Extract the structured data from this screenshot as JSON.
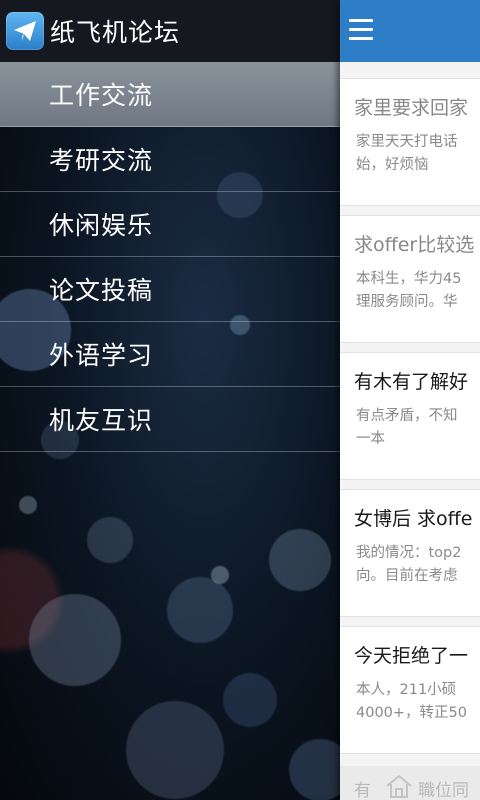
{
  "app": {
    "title": "纸飞机论坛",
    "logo_icon": "paper-plane-icon"
  },
  "drawer": {
    "items": [
      {
        "label": "工作交流",
        "active": true
      },
      {
        "label": "考研交流",
        "active": false
      },
      {
        "label": "休闲娱乐",
        "active": false
      },
      {
        "label": "论文投稿",
        "active": false
      },
      {
        "label": "外语学习",
        "active": false
      },
      {
        "label": "机友互识",
        "active": false
      }
    ]
  },
  "toolbar": {
    "menu_icon": "hamburger-menu-icon",
    "color": "#2d7ec6"
  },
  "posts": [
    {
      "title": "家里要求回家",
      "excerpt": "家里天天打电话\n始，好烦恼",
      "read": true
    },
    {
      "title": "求offer比较选",
      "excerpt": "本科生，华力45\n理服务顾问。华",
      "read": true
    },
    {
      "title": "有木有了解好",
      "excerpt": "有点矛盾，不知\n一本",
      "read": false
    },
    {
      "title": "女博后 求offe",
      "excerpt": "我的情况：top2\n向。目前在考虑",
      "read": false
    },
    {
      "title": "今天拒绝了一",
      "excerpt": "本人，211小硕\n4000+，转正50",
      "read": false
    }
  ],
  "footer": {
    "prefix": "有",
    "suffix": "職位同",
    "icon": "home-icon"
  }
}
